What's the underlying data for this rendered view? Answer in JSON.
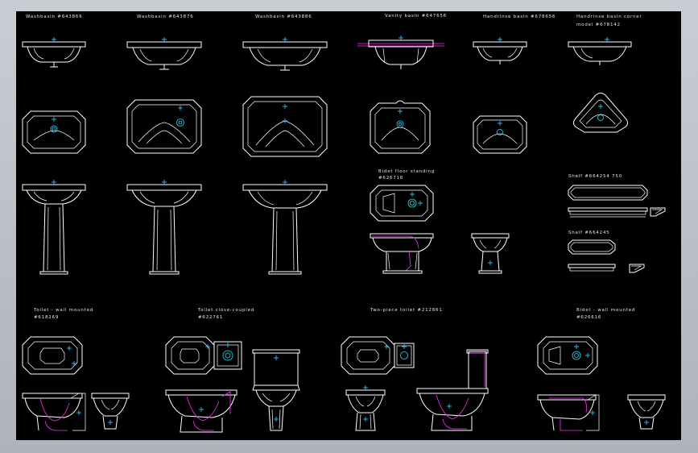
{
  "colors": {
    "background": "#000000",
    "outline": "#ffffff",
    "accent_magenta": "#ff2cff",
    "accent_cyan": "#28e0ff"
  },
  "labels": {
    "washbasin_1": "Washbasin #643866",
    "washbasin_2": "Washbasin #643876",
    "washbasin_3": "Washbasin #643886",
    "vanity_basin": "Vanity basin #647656",
    "handrinse_basin": "Handrinse basin #678656",
    "handrinse_corner_1": "Handrinse basin corner",
    "handrinse_corner_2": "model #678142",
    "bidet_floor_1": "Bidet floor standing",
    "bidet_floor_2": "#626716",
    "shelf_1": "Shelf #664254 750",
    "shelf_2": "Shelf #664245",
    "toilet_wall_1": "Toilet - wall mounted",
    "toilet_wall_2": "#618269",
    "toilet_close_1": "Toilet close-coupled",
    "toilet_close_2": "#622761",
    "two_piece": "Two-piece toilet #212861",
    "bidet_wall_1": "Bidet - wall mounted",
    "bidet_wall_2": "#626616"
  }
}
